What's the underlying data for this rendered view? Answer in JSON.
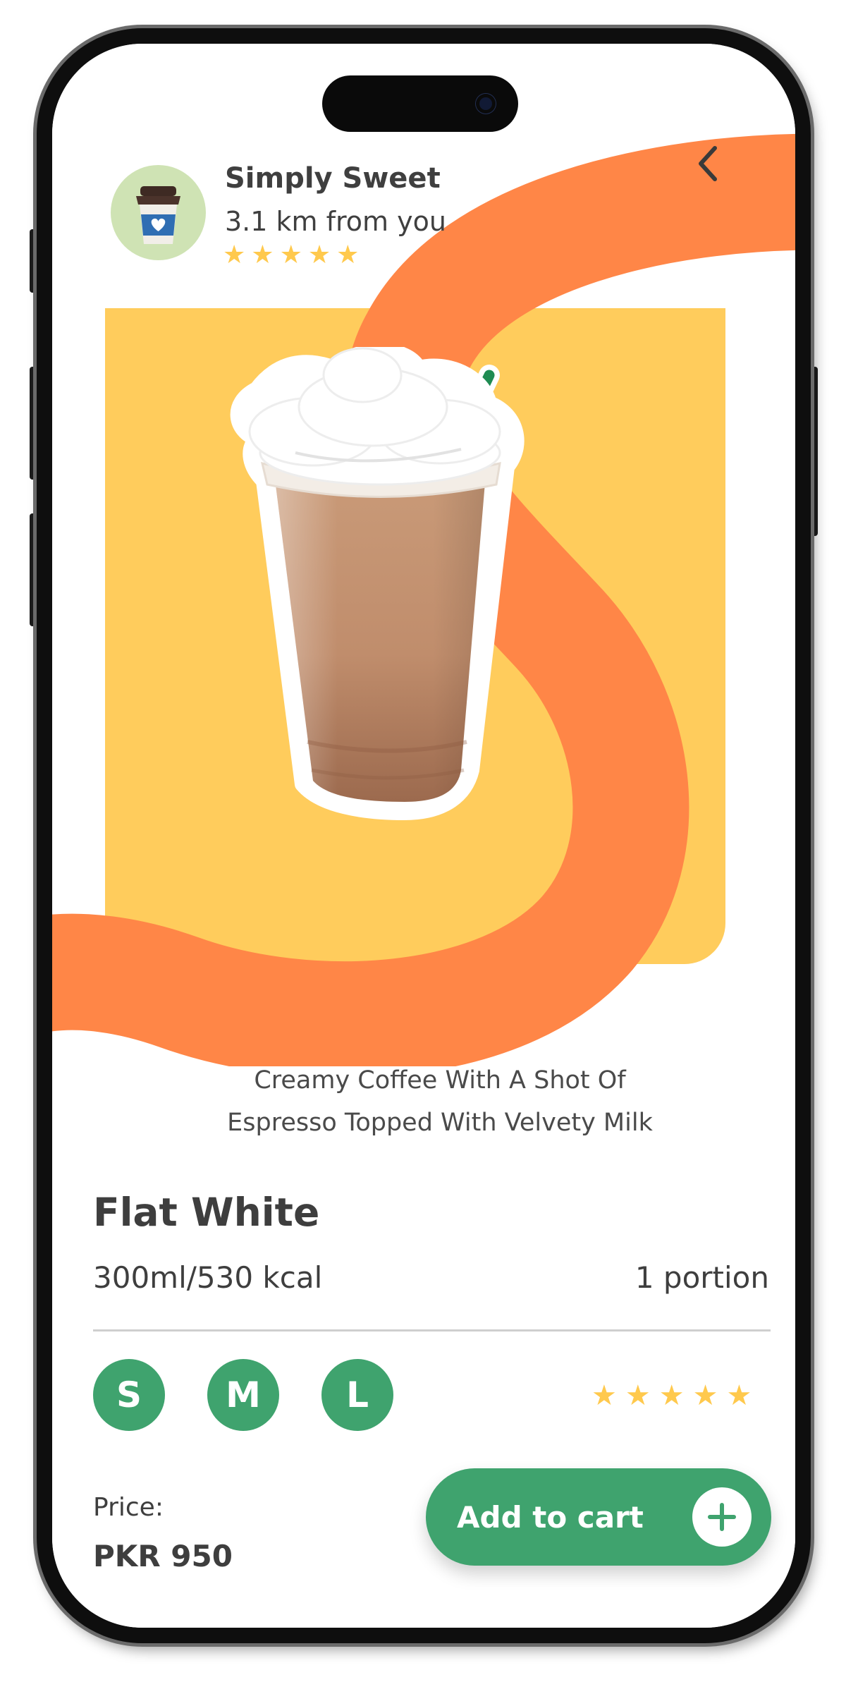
{
  "shop": {
    "name": "Simply Sweet",
    "distance": "3.1 km from you",
    "rating": 5
  },
  "product": {
    "description_line1": "Creamy Coffee With A Shot Of",
    "description_line2": "Espresso Topped With Velvety Milk",
    "name": "Flat White",
    "volume": "300ml/530 kcal",
    "portion": "1 portion",
    "rating": 5
  },
  "sizes": {
    "small": "S",
    "medium": "M",
    "large": "L"
  },
  "price": {
    "label": "Price:",
    "value": "PKR 950"
  },
  "cart": {
    "label": "Add to cart"
  },
  "icons": {
    "back": "chevron-left-icon",
    "add": "plus-icon",
    "avatar": "coffee-cup-icon",
    "star": "star-icon"
  },
  "colors": {
    "accent_green": "#3FA36E",
    "orange_wave": "#FF8647",
    "yellow_card": "#FFCC5C",
    "star": "#FFC94D",
    "text": "#3E3E3E",
    "avatar_bg": "#CFE3B4"
  }
}
